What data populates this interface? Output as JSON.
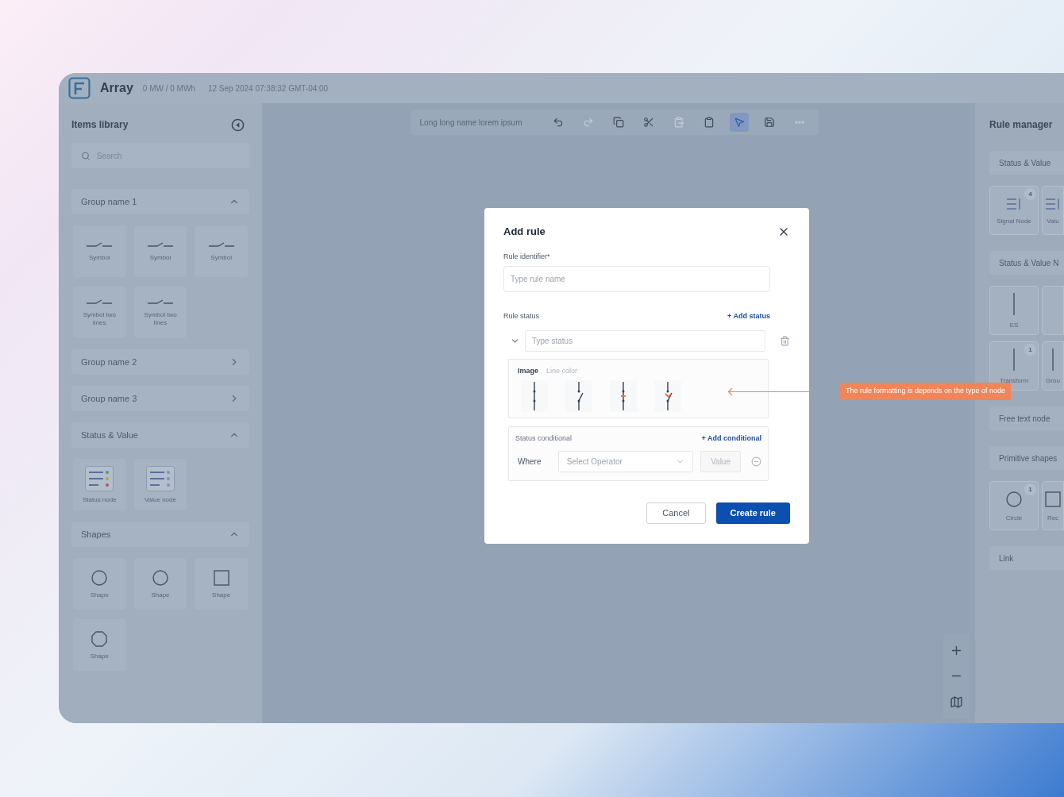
{
  "header": {
    "app_name": "Array",
    "power": "0 MW / 0 MWh",
    "timestamp": "12 Sep 2024 07:38:32 GMT-04:00"
  },
  "library": {
    "title": "Items library",
    "search": {
      "placeholder": "Search"
    },
    "groups": [
      {
        "name": "Group name 1",
        "expanded": true,
        "items": [
          {
            "label": "Symbol",
            "kind": "symbol"
          },
          {
            "label": "Symbol",
            "kind": "symbol"
          },
          {
            "label": "Symbol",
            "kind": "symbol"
          },
          {
            "label": "Symbol two lines",
            "kind": "symbol"
          },
          {
            "label": "Symbol two lines",
            "kind": "symbol"
          }
        ]
      },
      {
        "name": "Group name 2",
        "expanded": false
      },
      {
        "name": "Group name 3",
        "expanded": false
      },
      {
        "name": "Status & Value",
        "expanded": true,
        "items": [
          {
            "label": "Status node",
            "kind": "status"
          },
          {
            "label": "Value node",
            "kind": "value"
          }
        ]
      },
      {
        "name": "Shapes",
        "expanded": true,
        "items": [
          {
            "label": "Shape",
            "kind": "circle"
          },
          {
            "label": "Shape",
            "kind": "circle"
          },
          {
            "label": "Shape",
            "kind": "square"
          },
          {
            "label": "Shape",
            "kind": "octagon"
          }
        ]
      }
    ]
  },
  "toolbar": {
    "name": "Long long name lorem ipsum",
    "tools": [
      {
        "kind": "undo",
        "disabled": false,
        "selected": false
      },
      {
        "kind": "redo",
        "disabled": true,
        "selected": false
      },
      {
        "kind": "copy",
        "disabled": false,
        "selected": false
      },
      {
        "kind": "cut",
        "disabled": false,
        "selected": false
      },
      {
        "kind": "paste",
        "disabled": true,
        "selected": false
      },
      {
        "kind": "clipboard",
        "disabled": false,
        "selected": false
      },
      {
        "kind": "select",
        "disabled": false,
        "selected": true
      },
      {
        "kind": "save",
        "disabled": false,
        "selected": false
      },
      {
        "kind": "more",
        "disabled": true,
        "selected": false
      }
    ]
  },
  "zoom_controls": [
    {
      "kind": "zoom-in"
    },
    {
      "kind": "zoom-out"
    },
    {
      "kind": "map"
    }
  ],
  "rule_manager": {
    "title": "Rule manager",
    "sections": [
      {
        "name": "Status & Value",
        "items": [
          {
            "label": "Signal Node",
            "kind": "list",
            "badge": "4"
          },
          {
            "label": "Valu",
            "kind": "list"
          }
        ]
      },
      {
        "name": "Status & Value N",
        "items": [
          {
            "label": "ES",
            "kind": "line"
          },
          {
            "kind": "blank"
          },
          {
            "label": "Transform",
            "kind": "line",
            "badge": "1"
          },
          {
            "label": "Grou",
            "kind": "line"
          }
        ]
      },
      {
        "name": "Free text node"
      },
      {
        "name": "Primitive shapes",
        "items": [
          {
            "label": "Circle",
            "kind": "circle",
            "badge": "1"
          },
          {
            "label": "Rec",
            "kind": "square"
          }
        ]
      },
      {
        "name": "Link"
      }
    ]
  },
  "modal": {
    "title": "Add rule",
    "identifier": {
      "label": "Rule identifier*",
      "placeholder": "Type rule name"
    },
    "status": {
      "label": "Rule status",
      "add_link": "+ Add status",
      "expanded": true,
      "placeholder": "Type status",
      "tabs": [
        {
          "label": "Image",
          "selected": true
        },
        {
          "label": "Line color",
          "selected": false
        }
      ],
      "images": [
        {
          "kind": "closed"
        },
        {
          "kind": "open"
        },
        {
          "kind": "closed-marked"
        },
        {
          "kind": "open-marked"
        }
      ],
      "conditional": {
        "label": "Status conditional",
        "add_link": "+ Add conditional",
        "where": "Where",
        "operator_placeholder": "Select Operator",
        "value_placeholder": "Value"
      }
    },
    "buttons": [
      {
        "label": "Cancel",
        "kind": "secondary"
      },
      {
        "label": "Create rule",
        "kind": "primary"
      }
    ]
  },
  "annotation": {
    "text": "The rule formatting is depends on the type of node"
  }
}
